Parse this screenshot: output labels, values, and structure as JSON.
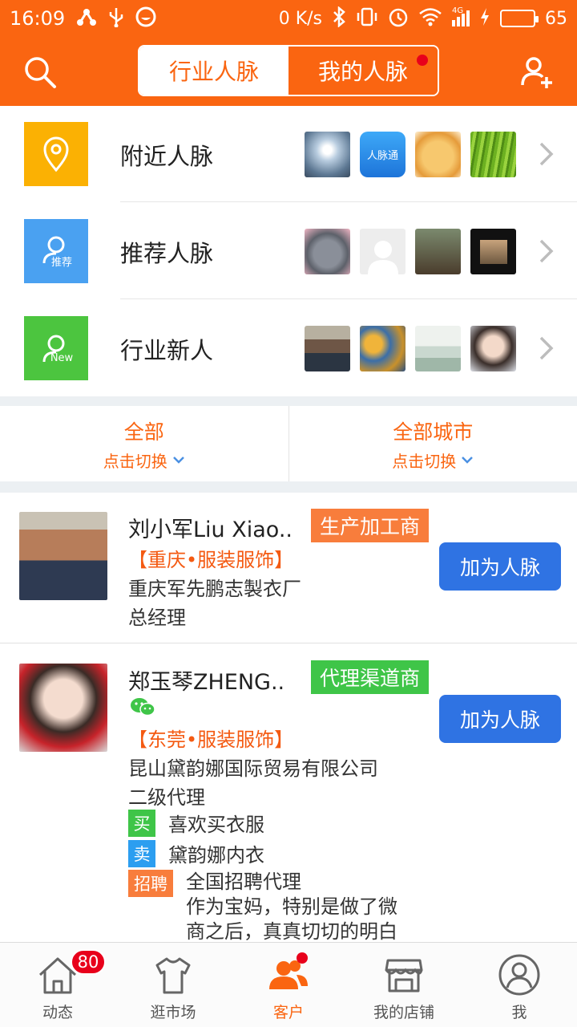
{
  "statusbar": {
    "time": "16:09",
    "net_speed": "0 K/s",
    "network": "4G",
    "battery": "65",
    "battery_level": 0.65
  },
  "header": {
    "tabs": [
      {
        "label": "行业人脉",
        "active": true
      },
      {
        "label": "我的人脉",
        "active": false,
        "has_dot": true
      }
    ],
    "search_icon": "search-icon",
    "add_icon": "add-user-icon"
  },
  "discover": [
    {
      "label": "附近人脉",
      "icon": "location-pin-icon",
      "color": "#fbb103",
      "badge_text": ""
    },
    {
      "label": "推荐人脉",
      "icon": "user-recommend-icon",
      "color": "#4aa1f1",
      "badge_text": "推荐"
    },
    {
      "label": "行业新人",
      "icon": "user-new-icon",
      "color": "#4cc53f",
      "badge_text": "New"
    }
  ],
  "discover_thumb_text": "人脉通",
  "filters": {
    "left": {
      "main": "全部",
      "sub": "点击切换"
    },
    "right": {
      "main": "全部城市",
      "sub": "点击切换"
    }
  },
  "contacts": [
    {
      "name": "刘小军Liu Xiao..",
      "tag": "生产加工商",
      "tag_color": "#f87d3c",
      "region": "【重庆•服装服饰】",
      "company": "重庆军先鹏志製衣厂",
      "title": "总经理",
      "action": "加为人脉"
    },
    {
      "name": "郑玉琴ZHENG..",
      "tag": "代理渠道商",
      "tag_color": "#3fc548",
      "wechat_icon": "wechat-icon",
      "region": "【东莞•服装服饰】",
      "company": "昆山黛韵娜国际贸易有限公司",
      "title": "二级代理",
      "buy_label": "买",
      "buy_text": "喜欢买衣服",
      "sell_label": "卖",
      "sell_text": "黛韵娜内衣",
      "recruit_label": "招聘",
      "recruit_line1": "全国招聘代理",
      "recruit_line2": "作为宝妈，特别是做了微",
      "recruit_line3": "商之后，真真切切的明白",
      "action": "加为人脉"
    }
  ],
  "tabbar": [
    {
      "label": "动态",
      "icon": "home-icon",
      "badge": "80"
    },
    {
      "label": "逛市场",
      "icon": "shirt-icon"
    },
    {
      "label": "客户",
      "icon": "customers-icon",
      "active": true,
      "has_dot": true
    },
    {
      "label": "我的店铺",
      "icon": "shop-icon"
    },
    {
      "label": "我",
      "icon": "profile-icon"
    }
  ],
  "colors": {
    "brand": "#fa6511",
    "button_blue": "#2f73e3",
    "badge_red": "#e8001b"
  }
}
